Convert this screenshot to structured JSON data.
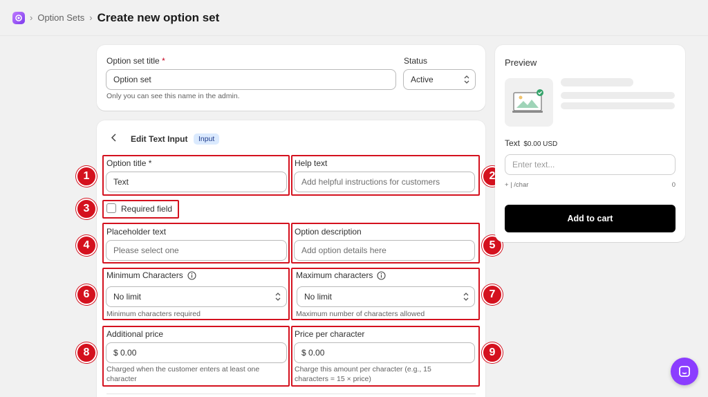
{
  "breadcrumb": {
    "parent": "Option Sets",
    "separator": "›",
    "current": "Create new option set"
  },
  "top_card": {
    "title_label": "Option set title",
    "title_required": "*",
    "title_value": "Option set",
    "title_hint": "Only you can see this name in the admin.",
    "status_label": "Status",
    "status_value": "Active"
  },
  "editor": {
    "back_icon": "chevron-left-icon",
    "heading": "Edit Text Input",
    "badge": "Input",
    "option_title_label": "Option title",
    "option_title_required": "*",
    "option_title_value": "Text",
    "help_text_label": "Help text",
    "help_text_placeholder": "Add helpful instructions for customers",
    "required_label": "Required field",
    "placeholder_label": "Placeholder text",
    "placeholder_value": "Please select one",
    "description_label": "Option description",
    "description_placeholder": "Add option details here",
    "min_label": "Minimum Characters",
    "min_value": "No limit",
    "min_hint": "Minimum characters required",
    "max_label": "Maximum characters",
    "max_value": "No limit",
    "max_hint": "Maximum number of characters allowed",
    "add_price_label": "Additional price",
    "add_price_value": "$ 0.00",
    "add_price_hint": "Charged when the customer enters at least one character",
    "ppc_label": "Price per character",
    "ppc_value": "$ 0.00",
    "ppc_hint": "Charge this amount per character (e.g., 15 characters = 15 × price)"
  },
  "annotations": [
    "1",
    "2",
    "3",
    "4",
    "5",
    "6",
    "7",
    "8",
    "9"
  ],
  "preview": {
    "title": "Preview",
    "option_label": "Text",
    "option_price": "$0.00 USD",
    "input_placeholder": "Enter text...",
    "char_note": "+ | /char",
    "char_count": "0",
    "add_to_cart": "Add to cart"
  },
  "colors": {
    "annotation_red": "#d4111e",
    "badge_bg": "#dbeafe",
    "chat_purple": "#8b3dff",
    "button_black": "#000000"
  }
}
